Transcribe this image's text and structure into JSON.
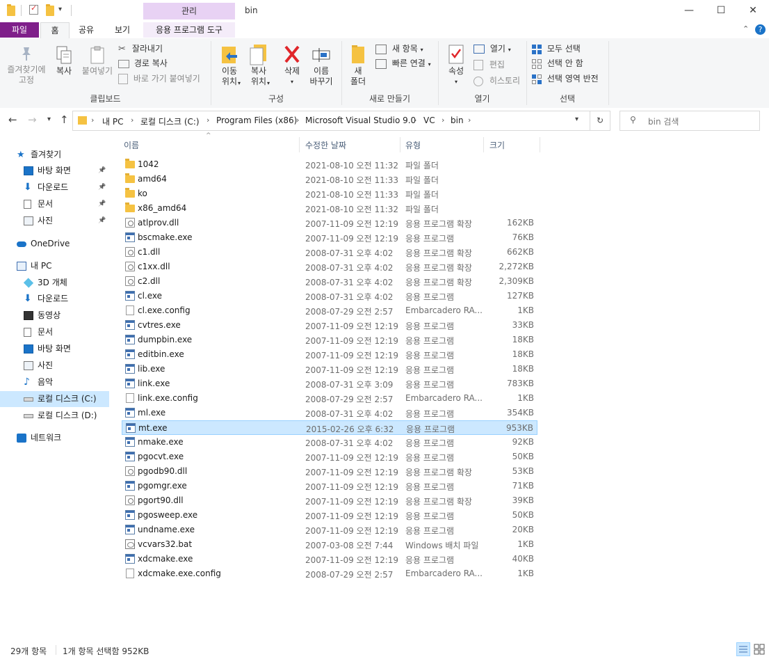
{
  "window": {
    "title": "bin",
    "contextual_tab": "관리",
    "controls": {
      "minimize": "—",
      "maximize": "☐",
      "close": "✕"
    }
  },
  "ribbon_tabs": {
    "file": "파일",
    "home": "홈",
    "share": "공유",
    "view": "보기",
    "app_tools": "응용 프로그램 도구"
  },
  "ribbon": {
    "clipboard": {
      "label": "클립보드",
      "pin_quick": "즐겨찾기에\n고정",
      "copy": "복사",
      "paste": "붙여넣기",
      "cut": "잘라내기",
      "copy_path": "경로 복사",
      "paste_shortcut": "바로 가기 붙여넣기"
    },
    "organize": {
      "label": "구성",
      "move_to": "이동\n위치",
      "copy_to": "복사\n위치",
      "delete": "삭제",
      "rename": "이름\n바꾸기"
    },
    "new": {
      "label": "새로 만들기",
      "new_folder": "새\n폴더",
      "new_item": "새 항목",
      "easy_access": "빠른 연결"
    },
    "open": {
      "label": "열기",
      "properties": "속성",
      "open": "열기",
      "edit": "편집",
      "history": "히스토리"
    },
    "select": {
      "label": "선택",
      "select_all": "모두 선택",
      "select_none": "선택 안 함",
      "invert": "선택 영역 반전"
    }
  },
  "address": {
    "crumbs": [
      "내 PC",
      "로컬 디스크 (C:)",
      "Program Files (x86)",
      "Microsoft Visual Studio 9.0",
      "VC",
      "bin"
    ],
    "search_placeholder": "bin 검색"
  },
  "nav_pane": [
    {
      "label": "즐겨찾기",
      "icon": "star-icon",
      "level": 0,
      "pinned": false
    },
    {
      "label": "바탕 화면",
      "icon": "desktop-icon",
      "level": 1,
      "pinned": true
    },
    {
      "label": "다운로드",
      "icon": "download-icon",
      "level": 1,
      "pinned": true
    },
    {
      "label": "문서",
      "icon": "document-icon",
      "level": 1,
      "pinned": true
    },
    {
      "label": "사진",
      "icon": "picture-icon",
      "level": 1,
      "pinned": true
    },
    {
      "label": "OneDrive",
      "icon": "cloud-icon",
      "level": 0,
      "pinned": false
    },
    {
      "label": "내 PC",
      "icon": "computer-icon",
      "level": 0,
      "pinned": false
    },
    {
      "label": "3D 개체",
      "icon": "cube-icon",
      "level": 1,
      "pinned": false
    },
    {
      "label": "다운로드",
      "icon": "download-icon",
      "level": 1,
      "pinned": false
    },
    {
      "label": "동영상",
      "icon": "video-icon",
      "level": 1,
      "pinned": false
    },
    {
      "label": "문서",
      "icon": "document-icon",
      "level": 1,
      "pinned": false
    },
    {
      "label": "바탕 화면",
      "icon": "desktop-icon",
      "level": 1,
      "pinned": false
    },
    {
      "label": "사진",
      "icon": "picture-icon",
      "level": 1,
      "pinned": false
    },
    {
      "label": "음악",
      "icon": "music-icon",
      "level": 1,
      "pinned": false
    },
    {
      "label": "로컬 디스크 (C:)",
      "icon": "drive-icon",
      "level": 1,
      "pinned": false,
      "selected": true
    },
    {
      "label": "로컬 디스크 (D:)",
      "icon": "drive-icon",
      "level": 1,
      "pinned": false
    },
    {
      "label": "네트워크",
      "icon": "network-icon",
      "level": 0,
      "pinned": false
    }
  ],
  "columns": {
    "name": "이름",
    "date": "수정한 날짜",
    "type": "유형",
    "size": "크기"
  },
  "files": [
    {
      "name": "1042",
      "date": "2021-08-10 오전 11:32",
      "type": "파일 폴더",
      "size": "",
      "kind": "folder"
    },
    {
      "name": "amd64",
      "date": "2021-08-10 오전 11:33",
      "type": "파일 폴더",
      "size": "",
      "kind": "folder"
    },
    {
      "name": "ko",
      "date": "2021-08-10 오전 11:33",
      "type": "파일 폴더",
      "size": "",
      "kind": "folder"
    },
    {
      "name": "x86_amd64",
      "date": "2021-08-10 오전 11:32",
      "type": "파일 폴더",
      "size": "",
      "kind": "folder"
    },
    {
      "name": "atlprov.dll",
      "date": "2007-11-09 오전 12:19",
      "type": "응용 프로그램 확장",
      "size": "162KB",
      "kind": "dll"
    },
    {
      "name": "bscmake.exe",
      "date": "2007-11-09 오전 12:19",
      "type": "응용 프로그램",
      "size": "76KB",
      "kind": "exe"
    },
    {
      "name": "c1.dll",
      "date": "2008-07-31 오후 4:02",
      "type": "응용 프로그램 확장",
      "size": "662KB",
      "kind": "dll"
    },
    {
      "name": "c1xx.dll",
      "date": "2008-07-31 오후 4:02",
      "type": "응용 프로그램 확장",
      "size": "2,272KB",
      "kind": "dll"
    },
    {
      "name": "c2.dll",
      "date": "2008-07-31 오후 4:02",
      "type": "응용 프로그램 확장",
      "size": "2,309KB",
      "kind": "dll"
    },
    {
      "name": "cl.exe",
      "date": "2008-07-31 오후 4:02",
      "type": "응용 프로그램",
      "size": "127KB",
      "kind": "exe"
    },
    {
      "name": "cl.exe.config",
      "date": "2008-07-29 오전 2:57",
      "type": "Embarcadero RA...",
      "size": "1KB",
      "kind": "cfg"
    },
    {
      "name": "cvtres.exe",
      "date": "2007-11-09 오전 12:19",
      "type": "응용 프로그램",
      "size": "33KB",
      "kind": "exe"
    },
    {
      "name": "dumpbin.exe",
      "date": "2007-11-09 오전 12:19",
      "type": "응용 프로그램",
      "size": "18KB",
      "kind": "exe"
    },
    {
      "name": "editbin.exe",
      "date": "2007-11-09 오전 12:19",
      "type": "응용 프로그램",
      "size": "18KB",
      "kind": "exe"
    },
    {
      "name": "lib.exe",
      "date": "2007-11-09 오전 12:19",
      "type": "응용 프로그램",
      "size": "18KB",
      "kind": "exe"
    },
    {
      "name": "link.exe",
      "date": "2008-07-31 오후 3:09",
      "type": "응용 프로그램",
      "size": "783KB",
      "kind": "exe"
    },
    {
      "name": "link.exe.config",
      "date": "2008-07-29 오전 2:57",
      "type": "Embarcadero RA...",
      "size": "1KB",
      "kind": "cfg"
    },
    {
      "name": "ml.exe",
      "date": "2008-07-31 오후 4:02",
      "type": "응용 프로그램",
      "size": "354KB",
      "kind": "exe"
    },
    {
      "name": "mt.exe",
      "date": "2015-02-26 오후 6:32",
      "type": "응용 프로그램",
      "size": "953KB",
      "kind": "exe",
      "selected": true
    },
    {
      "name": "nmake.exe",
      "date": "2008-07-31 오후 4:02",
      "type": "응용 프로그램",
      "size": "92KB",
      "kind": "exe"
    },
    {
      "name": "pgocvt.exe",
      "date": "2007-11-09 오전 12:19",
      "type": "응용 프로그램",
      "size": "50KB",
      "kind": "exe"
    },
    {
      "name": "pgodb90.dll",
      "date": "2007-11-09 오전 12:19",
      "type": "응용 프로그램 확장",
      "size": "53KB",
      "kind": "dll"
    },
    {
      "name": "pgomgr.exe",
      "date": "2007-11-09 오전 12:19",
      "type": "응용 프로그램",
      "size": "71KB",
      "kind": "exe"
    },
    {
      "name": "pgort90.dll",
      "date": "2007-11-09 오전 12:19",
      "type": "응용 프로그램 확장",
      "size": "39KB",
      "kind": "dll"
    },
    {
      "name": "pgosweep.exe",
      "date": "2007-11-09 오전 12:19",
      "type": "응용 프로그램",
      "size": "50KB",
      "kind": "exe"
    },
    {
      "name": "undname.exe",
      "date": "2007-11-09 오전 12:19",
      "type": "응용 프로그램",
      "size": "20KB",
      "kind": "exe"
    },
    {
      "name": "vcvars32.bat",
      "date": "2007-03-08 오전 7:44",
      "type": "Windows 배치 파일",
      "size": "1KB",
      "kind": "bat"
    },
    {
      "name": "xdcmake.exe",
      "date": "2007-11-09 오전 12:19",
      "type": "응용 프로그램",
      "size": "40KB",
      "kind": "exe"
    },
    {
      "name": "xdcmake.exe.config",
      "date": "2008-07-29 오전 2:57",
      "type": "Embarcadero RA...",
      "size": "1KB",
      "kind": "cfg"
    }
  ],
  "status": {
    "item_count": "29개 항목",
    "selection": "1개 항목 선택함 952KB"
  },
  "colors": {
    "file_tab": "#7f1f8a",
    "contextual": "#e8d2f4",
    "selection": "#cce8ff",
    "selection_border": "#99d1ff"
  }
}
